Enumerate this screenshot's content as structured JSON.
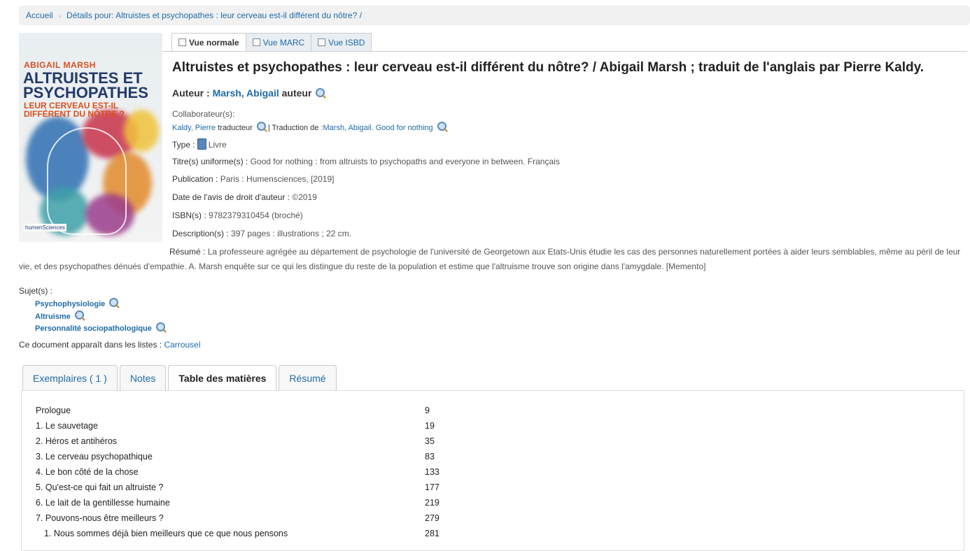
{
  "breadcrumb": {
    "home": "Accueil",
    "current": "Détails pour: Altruistes et psychopathes : leur cerveau est-il différent du nôtre? /"
  },
  "cover": {
    "author": "ABIGAIL MARSH",
    "title_line1": "ALTRUISTES ET",
    "title_line2": "PSYCHOPATHES",
    "subtitle_line1": "LEUR CERVEAU EST-IL",
    "subtitle_line2": "DIFFÉRENT DU NÔTRE ?",
    "publisher": "humenSciences"
  },
  "view_tabs": [
    "Vue normale",
    "Vue MARC",
    "Vue ISBD"
  ],
  "record": {
    "title": "Altruistes et psychopathes : leur cerveau est-il différent du nôtre? / Abigail Marsh ; traduit de l'anglais par Pierre Kaldy.",
    "author_label": "Auteur :",
    "author_name": "Marsh, Abigail",
    "author_role": "auteur",
    "collab_label": "Collaborateur(s):",
    "collab_name": "Kaldy, Pierre",
    "collab_role": "traducteur",
    "translation_of_label": "| Traduction de :",
    "translation_of": "Marsh, Abigail. Good for nothing",
    "type_label": "Type :",
    "type_value": "Livre",
    "uniform_label": "Titre(s) uniforme(s) :",
    "uniform_value": "Good for nothing : from altruists to psychopaths and everyone in between. Français",
    "publication_label": "Publication :",
    "publication_value": "Paris : Humensciences, [2019]",
    "copyright_label": "Date de l'avis de droit d'auteur :",
    "copyright_value": "©2019",
    "isbn_label": "ISBN(s) :",
    "isbn_value": "9782379310454 (broché)",
    "description_label": "Description(s) :",
    "description_value": "397 pages : illustrations ; 22 cm.",
    "summary_label": "Résumé :",
    "summary_value": "La professeure agrégée au département de psychologie de l'université de Georgetown aux Etats-Unis étudie les cas des personnes naturellement portées à aider leurs semblables, même au péril de leur vie, et des psychopathes dénués d'empathie. A. Marsh enquête sur ce qui les distingue du reste de la population et estime que l'altruisme trouve son origine dans l'amygdale. [Memento]",
    "subjects_label": "Sujet(s) :",
    "subjects": [
      "Psychophysiologie",
      "Altruisme",
      "Personnalité sociopathologique"
    ],
    "lists_label": "Ce document apparaît dans les listes :",
    "lists_value": "Carrousel"
  },
  "content_tabs": [
    "Exemplaires ( 1 )",
    "Notes",
    "Table des matières",
    "Résumé"
  ],
  "toc": [
    {
      "chapter": "Prologue",
      "page": "9"
    },
    {
      "chapter": "1. Le sauvetage",
      "page": "19"
    },
    {
      "chapter": "2. Héros et antihéros",
      "page": "35"
    },
    {
      "chapter": "3. Le cerveau psychopathique",
      "page": "83"
    },
    {
      "chapter": "4. Le bon côté de la chose",
      "page": "133"
    },
    {
      "chapter": "5. Qu'est-ce qui fait un altruiste ?",
      "page": "177"
    },
    {
      "chapter": "6. Le lait de la gentillesse humaine",
      "page": "219"
    },
    {
      "chapter": "7. Pouvons-nous être meilleurs ?",
      "page": "279"
    },
    {
      "chapter": "1. Nous sommes déjà bien meilleurs que ce que nous pensons",
      "page": "281"
    }
  ]
}
